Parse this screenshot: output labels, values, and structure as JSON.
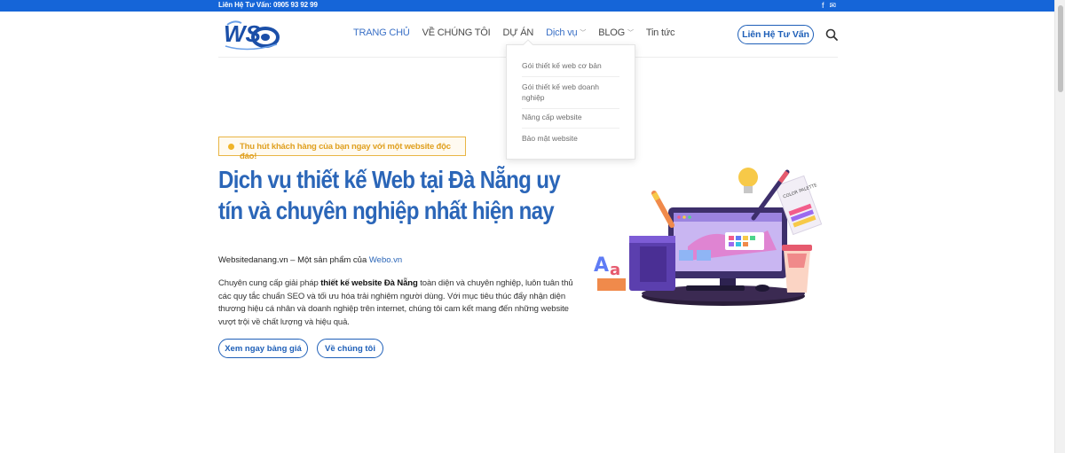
{
  "topbar": {
    "hotline": "Liên Hệ Tư Vấn: 0905 93 92 99",
    "social_icons": [
      "facebook-icon",
      "mail-icon"
    ],
    "color": "#1565d8"
  },
  "header": {
    "logo_text": "WS",
    "nav": [
      {
        "label": "TRANG CHỦ",
        "highlight": true
      },
      {
        "label": "VỀ CHÚNG TÔI",
        "highlight": false
      },
      {
        "label": "DỰ ÁN",
        "highlight": false
      },
      {
        "label": "Dịch vụ",
        "highlight": true,
        "has_dropdown": true
      },
      {
        "label": "BLOG",
        "highlight": false,
        "has_dropdown": true
      },
      {
        "label": "Tin tức",
        "highlight": false
      }
    ],
    "contact_button": "Liên Hệ Tư Vấn",
    "search_icon": "search-icon"
  },
  "dropdown": {
    "items": [
      "Gói thiết kế web cơ bản",
      "Gói thiết kế web doanh nghiệp",
      "Nâng cấp website",
      "Bảo mật website"
    ]
  },
  "hero": {
    "badge": "Thu hút khách hàng của bạn ngay với một website độc đáo!",
    "title": "Dịch vụ thiết kế Web tại Đà Nẵng uy tín và chuyên nghiệp nhất hiện nay",
    "intro_prefix": "Websitedanang.vn – Một sản phẩm của ",
    "intro_link": "Webo.vn",
    "para_before": "Chuyên cung cấp giải pháp ",
    "para_bold": "thiết kế website Đà Nẵng",
    "para_after": " toàn diện và chuyên nghiệp, luôn tuân thủ các quy tắc chuẩn SEO và tối ưu hóa trải nghiệm người dùng. Với mục tiêu thúc đẩy nhận diện thương hiệu cá nhân và doanh nghiệp trên internet, chúng tôi cam kết mang đến những website vượt trội về chất lượng và hiệu quả.",
    "button_primary": "Xem ngay bảng giá",
    "button_secondary": "Về chúng tôi"
  },
  "illustration": {
    "palette_label": "COLOR PALETTE"
  },
  "colors": {
    "brand_blue": "#2b66b8",
    "accent_yellow": "#f0b429"
  }
}
